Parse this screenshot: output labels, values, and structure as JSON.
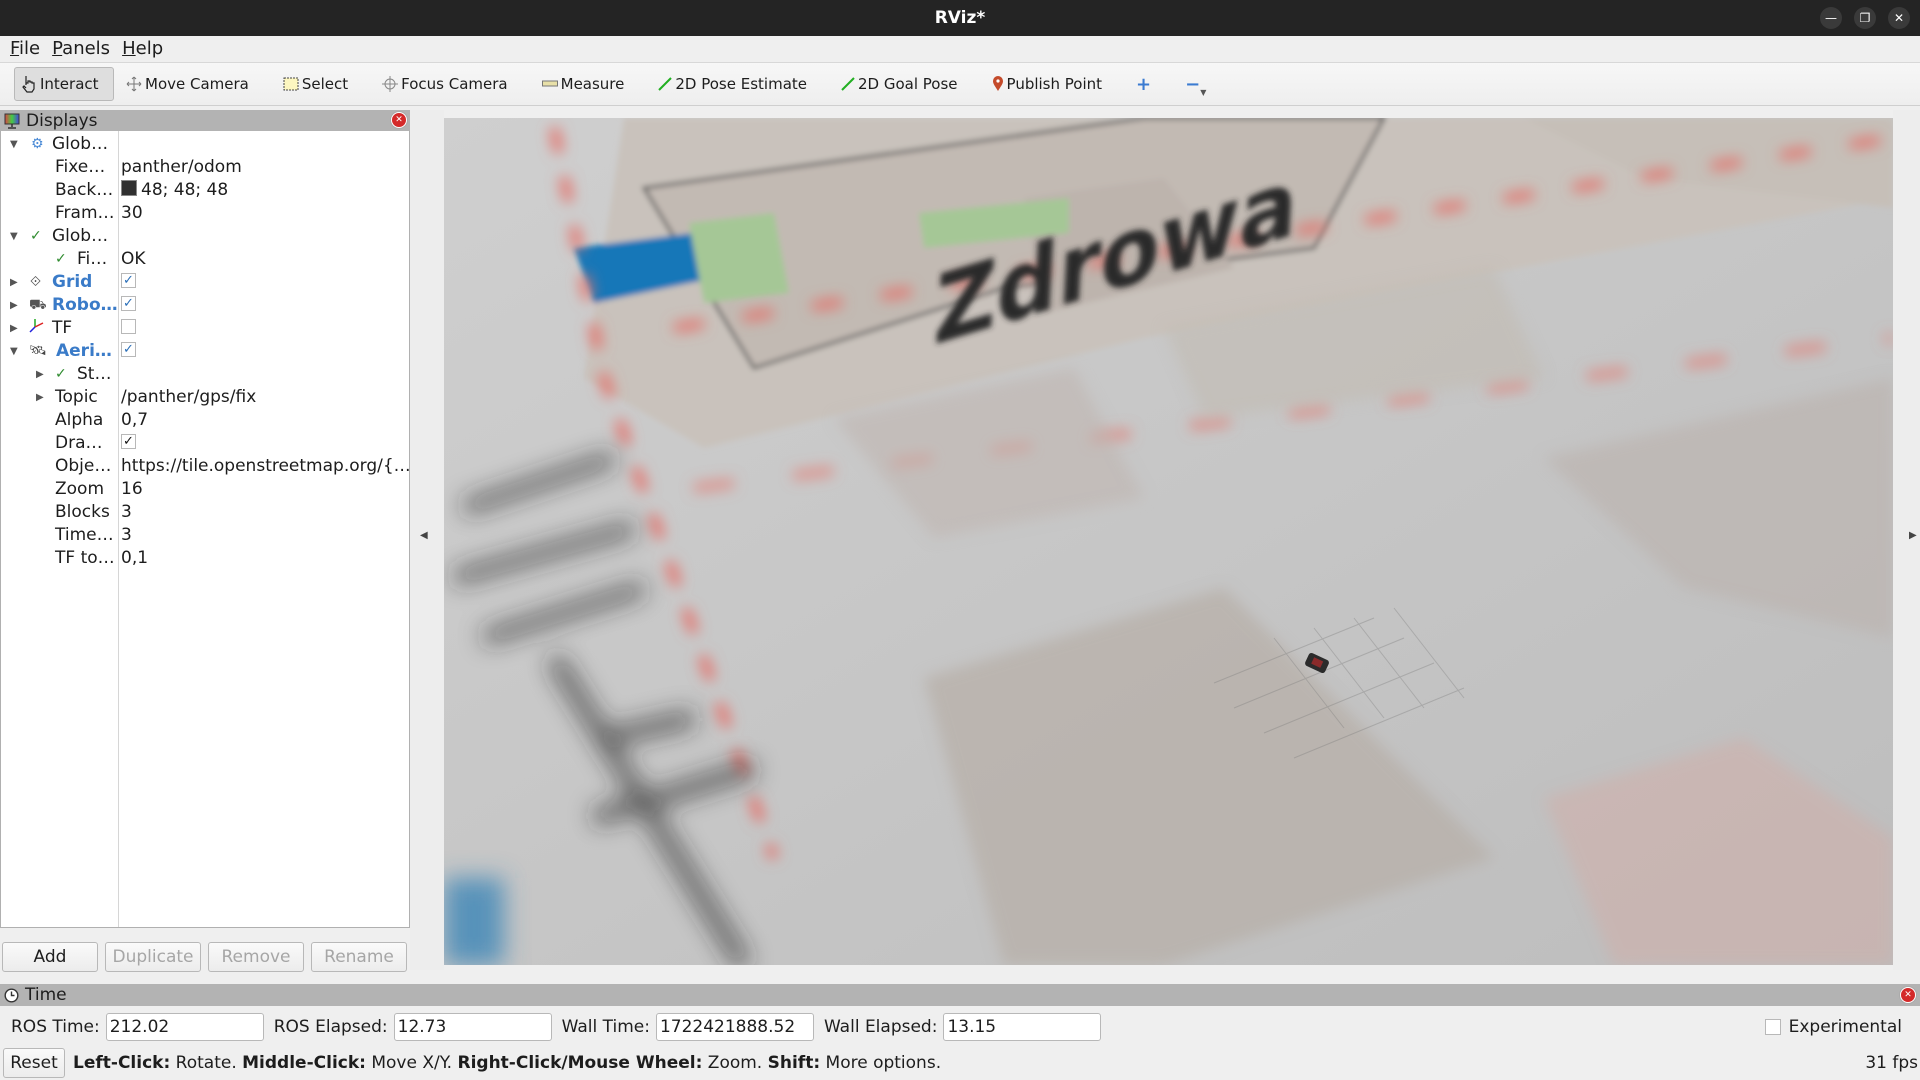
{
  "window": {
    "title": "RViz*",
    "controls": [
      "minimize",
      "restore",
      "close"
    ]
  },
  "menu": {
    "items": [
      {
        "label": "File",
        "mnemonic": "F",
        "rest": "ile"
      },
      {
        "label": "Panels",
        "mnemonic": "P",
        "rest": "anels"
      },
      {
        "label": "Help",
        "mnemonic": "H",
        "rest": "elp"
      }
    ]
  },
  "toolbar": {
    "interact": "Interact",
    "move_camera": "Move Camera",
    "select": "Select",
    "focus_camera": "Focus Camera",
    "measure": "Measure",
    "pose_estimate": "2D Pose Estimate",
    "goal_pose": "2D Goal Pose",
    "publish_point": "Publish Point",
    "add_tool": "+",
    "remove_tool": "−"
  },
  "displays": {
    "title": "Displays",
    "rows": [
      {
        "name": "Glob…",
        "value": "",
        "icon": "gear-icon",
        "expanded": true
      },
      {
        "name": "Fixe…",
        "value": "panther/odom"
      },
      {
        "name": "Back…",
        "value": "48; 48; 48",
        "swatch": "#303030"
      },
      {
        "name": "Fram…",
        "value": "30"
      },
      {
        "name": "Glob…",
        "value": "",
        "icon": "check-icon",
        "expanded": true
      },
      {
        "name": "Fi…",
        "value": "OK",
        "icon": "check-icon"
      },
      {
        "name": "Grid",
        "checked": true,
        "icon": "grid-icon"
      },
      {
        "name": "Robo…",
        "checked": true,
        "icon": "robot-model-icon"
      },
      {
        "name": "TF",
        "checked": false,
        "icon": "tf-axes-icon"
      },
      {
        "name": "Aeri…",
        "checked": true,
        "icon": "satellite-icon",
        "expanded": true
      },
      {
        "name": "St…",
        "value": "",
        "icon": "check-icon"
      },
      {
        "name": "Topic",
        "value": "/panther/gps/fix"
      },
      {
        "name": "Alpha",
        "value": "0,7"
      },
      {
        "name": "Dra…",
        "checked": true
      },
      {
        "name": "Obje…",
        "value": "https://tile.openstreetmap.org/{…"
      },
      {
        "name": "Zoom",
        "value": "16"
      },
      {
        "name": "Blocks",
        "value": "3"
      },
      {
        "name": "Time…",
        "value": "3"
      },
      {
        "name": "TF to…",
        "value": "0,1"
      }
    ],
    "buttons": {
      "add": "Add",
      "duplicate": "Duplicate",
      "remove": "Remove",
      "rename": "Rename"
    }
  },
  "viewport": {
    "map_labels": [
      "Zdrowa"
    ]
  },
  "time": {
    "title": "Time",
    "ros_time_label": "ROS Time:",
    "ros_time": "212.02",
    "ros_elapsed_label": "ROS Elapsed:",
    "ros_elapsed": "12.73",
    "wall_time_label": "Wall Time:",
    "wall_time": "1722421888.52",
    "wall_elapsed_label": "Wall Elapsed:",
    "wall_elapsed": "13.15",
    "experimental_label": "Experimental",
    "experimental": false
  },
  "status": {
    "reset": "Reset",
    "hint": [
      {
        "key": "Left-Click:",
        "text": " Rotate. "
      },
      {
        "key": "Middle-Click:",
        "text": " Move X/Y. "
      },
      {
        "key": "Right-Click/Mouse Wheel:",
        "text": " Zoom. "
      },
      {
        "key": "Shift:",
        "text": " More options."
      }
    ],
    "fps": "31 fps"
  },
  "colors": {
    "titlebar": "#242424",
    "panel_header": "#b3b3b3",
    "accent_blue": "#3a7bc8",
    "check_green": "#2e8b2e",
    "close_red": "#d42a2a"
  }
}
